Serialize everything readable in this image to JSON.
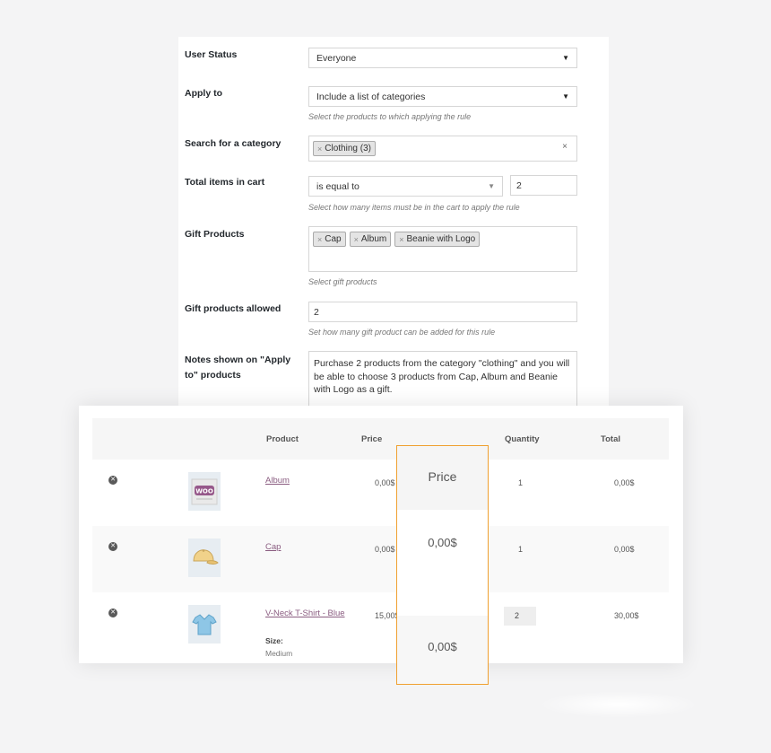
{
  "settings": {
    "user_status": {
      "label": "User Status",
      "value": "Everyone"
    },
    "apply_to": {
      "label": "Apply to",
      "value": "Include a list of categories",
      "help": "Select the products to which applying the rule"
    },
    "search_category": {
      "label": "Search for a category",
      "tags": [
        "Clothing (3)"
      ]
    },
    "total_items": {
      "label": "Total items in cart",
      "operator": "is equal to",
      "value": "2",
      "help": "Select how many items must be in the cart to apply the rule"
    },
    "gift_products": {
      "label": "Gift Products",
      "tags": [
        "Cap",
        "Album",
        "Beanie with Logo"
      ],
      "help": "Select gift products"
    },
    "gift_allowed": {
      "label": "Gift products allowed",
      "value": "2",
      "help": "Set how many gift product can be added for this rule"
    },
    "notes": {
      "label_line1": "Notes shown on \"Apply",
      "label_line2": "to\" products",
      "text": "Purchase 2 products from the category \"clothing\" and you will be able to choose 3 products from Cap, Album and Beanie with Logo as a gift."
    }
  },
  "cart": {
    "headers": {
      "product": "Product",
      "price": "Price",
      "quantity": "Quantity",
      "total": "Total"
    },
    "rows": [
      {
        "name": "Album",
        "price": "0,00$",
        "quantity": "1",
        "total": "0,00$",
        "thumb_icon": "album-woo-icon"
      },
      {
        "name": "Cap",
        "price": "0,00$",
        "quantity": "1",
        "total": "0,00$",
        "thumb_icon": "cap-icon"
      },
      {
        "name": "V-Neck T-Shirt - Blue",
        "price": "15,00$",
        "quantity": "2",
        "total": "30,00$",
        "variant_label": "Size:",
        "variant_value": "Medium",
        "thumb_icon": "tshirt-icon"
      }
    ]
  },
  "highlight": {
    "header": "Price",
    "values": [
      "0,00$",
      "0,00$"
    ],
    "border_color": "#f0a030"
  },
  "colors": {
    "link": "#8a5c80",
    "woo_purple": "#96588a"
  }
}
